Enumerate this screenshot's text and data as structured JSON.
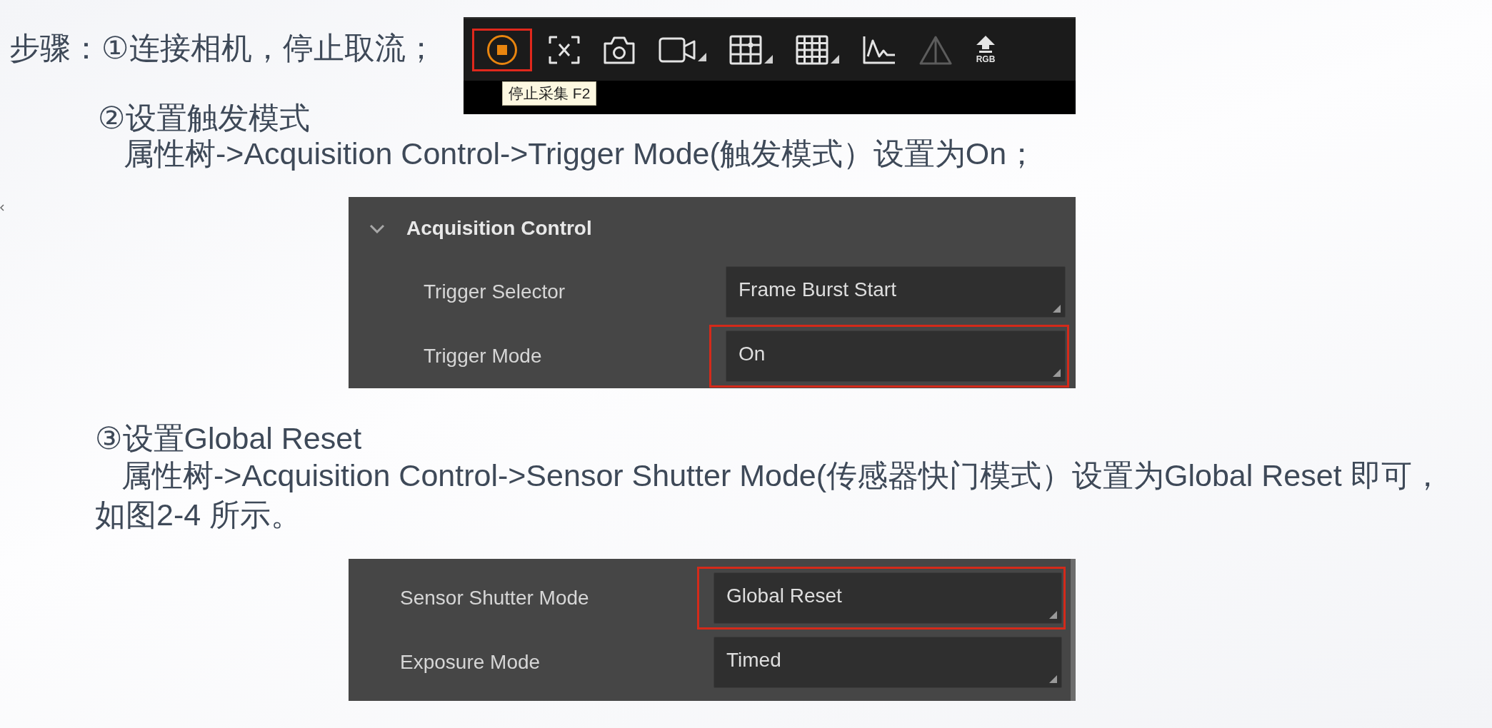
{
  "step_1": {
    "text": "步骤：①连接相机，停止取流；"
  },
  "toolbar": {
    "buttons": [
      {
        "kind": "stop",
        "active": true,
        "highlighted": true,
        "dropdown": false,
        "disabled": false
      },
      {
        "kind": "bracket-x",
        "active": false,
        "highlighted": false,
        "dropdown": false,
        "disabled": false
      },
      {
        "kind": "camera",
        "active": false,
        "highlighted": false,
        "dropdown": false,
        "disabled": false
      },
      {
        "kind": "video",
        "active": false,
        "highlighted": false,
        "dropdown": true,
        "disabled": false
      },
      {
        "kind": "grid-cross",
        "active": false,
        "highlighted": false,
        "dropdown": true,
        "disabled": false
      },
      {
        "kind": "grid",
        "active": false,
        "highlighted": false,
        "dropdown": true,
        "disabled": false
      },
      {
        "kind": "line-chart",
        "active": false,
        "highlighted": false,
        "dropdown": false,
        "disabled": false
      },
      {
        "kind": "triangle",
        "active": false,
        "highlighted": false,
        "dropdown": false,
        "disabled": true
      },
      {
        "kind": "up-arrow",
        "active": false,
        "highlighted": false,
        "dropdown": false,
        "disabled": false,
        "label": "RGB"
      }
    ],
    "tooltip": "停止采集 F2"
  },
  "step_2": {
    "heading": "②设置触发模式",
    "detail": "属性树->Acquisition Control->Trigger Mode(触发模式）设置为On；"
  },
  "panel_1": {
    "header": {
      "title": "Acquisition Control",
      "expanded": true
    },
    "rows": [
      {
        "label": "Trigger Selector",
        "value": "Frame Burst Start",
        "highlighted": false
      },
      {
        "label": "Trigger Mode",
        "value": "On",
        "highlighted": true
      }
    ]
  },
  "step_3": {
    "heading": "③设置Global Reset",
    "detail": "属性树->Acquisition Control->Sensor Shutter Mode(传感器快门模式）设置为Global Reset 即可，",
    "note": "如图2-4 所示。"
  },
  "panel_2": {
    "rows": [
      {
        "label": "Sensor Shutter Mode",
        "value": "Global Reset",
        "highlighted": true
      },
      {
        "label": "Exposure Mode",
        "value": "Timed",
        "highlighted": false
      }
    ]
  }
}
